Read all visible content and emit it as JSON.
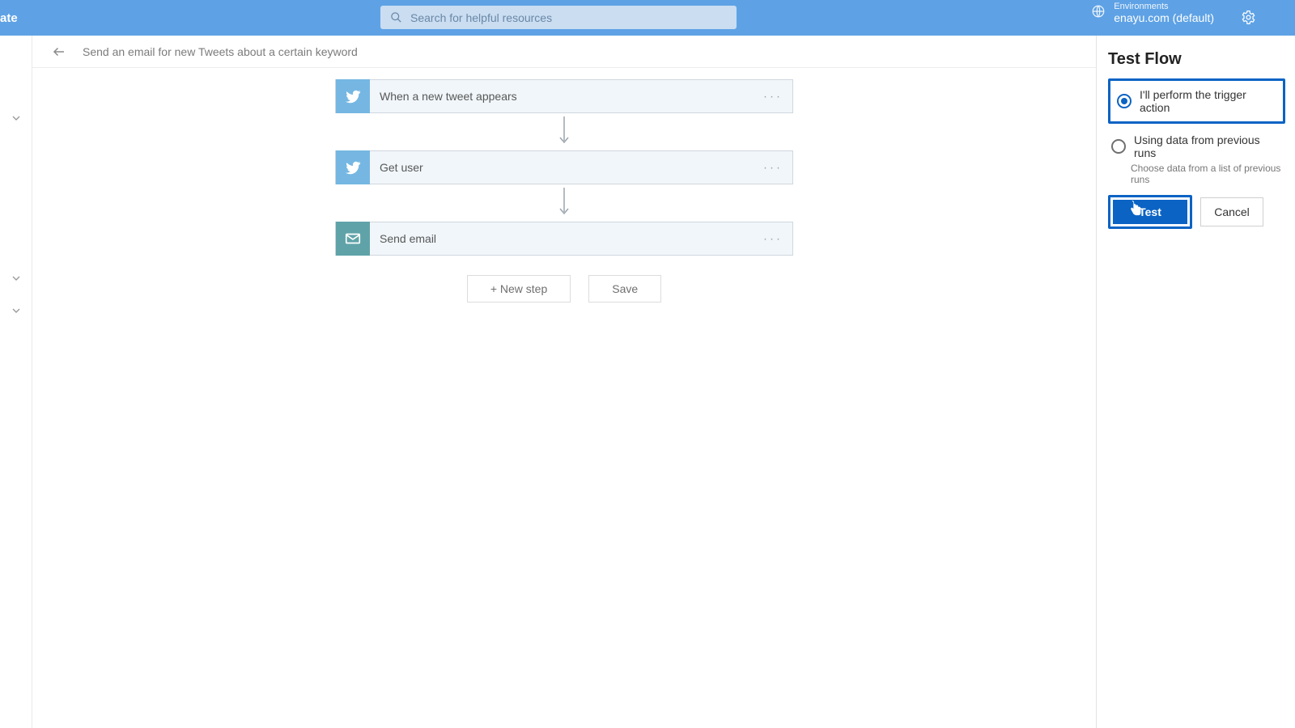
{
  "topbar": {
    "left_text": "ate",
    "search_placeholder": "Search for helpful resources",
    "env_label": "Environments",
    "env_name": "enayu.com (default)"
  },
  "breadcrumb": {
    "title": "Send an email for new Tweets about a certain keyword"
  },
  "steps": [
    {
      "icon": "twitter",
      "title": "When a new tweet appears"
    },
    {
      "icon": "twitter",
      "title": "Get user"
    },
    {
      "icon": "mail",
      "title": "Send email"
    }
  ],
  "actions": {
    "new_step": "+ New step",
    "save": "Save"
  },
  "test_panel": {
    "title": "Test Flow",
    "option_perform": "I'll perform the trigger action",
    "option_previous": "Using data from previous runs",
    "previous_hint": "Choose data from a list of previous runs",
    "btn_test": "Test",
    "btn_cancel": "Cancel"
  }
}
